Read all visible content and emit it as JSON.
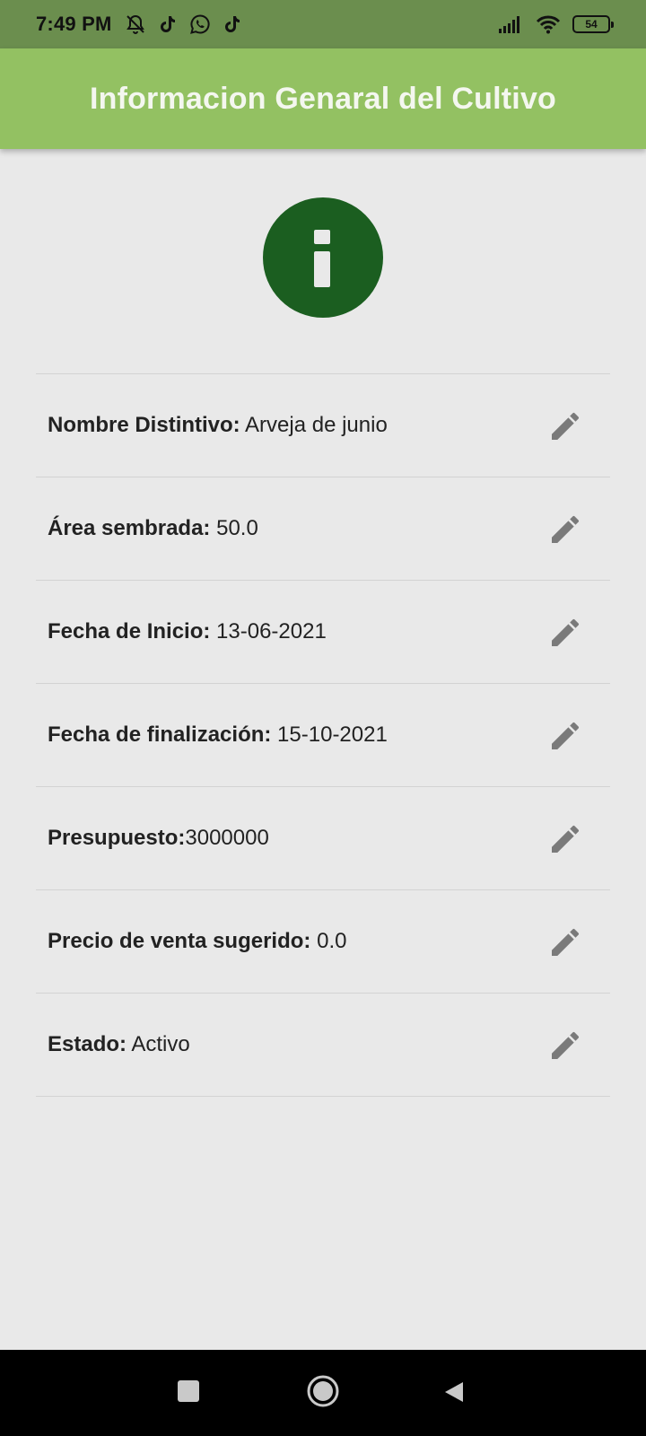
{
  "status_bar": {
    "time": "7:49 PM",
    "left_icons": [
      "bell-off-icon",
      "tiktok-icon",
      "whatsapp-icon",
      "tiktok-icon"
    ],
    "right_icons": [
      "signal-icon",
      "wifi-icon",
      "battery-icon"
    ],
    "battery_level": "54"
  },
  "app_bar": {
    "title": "Informacion Genaral del Cultivo",
    "color": "#93c162"
  },
  "header_icon": {
    "name": "info-icon",
    "color": "#1b5e20"
  },
  "fields": [
    {
      "label": "Nombre Distintivo:",
      "value": " Arveja de junio",
      "action_icon": "edit-icon"
    },
    {
      "label": "Área sembrada:",
      "value": " 50.0",
      "action_icon": "edit-icon"
    },
    {
      "label": "Fecha de Inicio:",
      "value": " 13-06-2021",
      "action_icon": "edit-icon"
    },
    {
      "label": "Fecha de finalización:",
      "value": " 15-10-2021",
      "action_icon": "edit-icon"
    },
    {
      "label": "Presupuesto:",
      "value": "3000000",
      "action_icon": "edit-icon"
    },
    {
      "label": "Precio de venta sugerido:",
      "value": " 0.0",
      "action_icon": "edit-icon"
    },
    {
      "label": "Estado:",
      "value": " Activo",
      "action_icon": "edit-icon"
    }
  ],
  "nav_bar": {
    "buttons": [
      "recents-button",
      "home-button",
      "back-button"
    ]
  }
}
